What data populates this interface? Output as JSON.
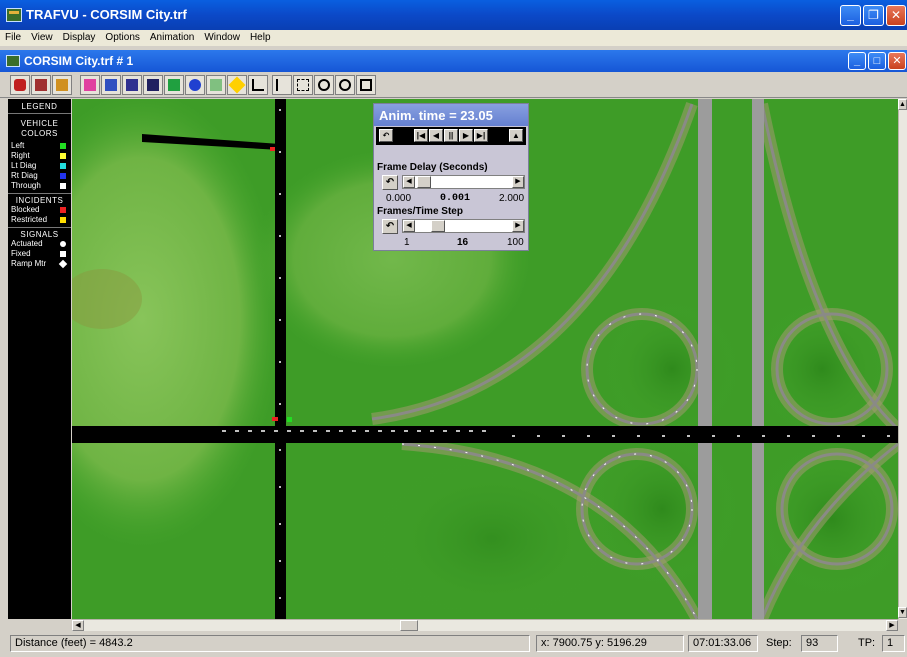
{
  "app": {
    "title": "TRAFVU - CORSIM City.trf"
  },
  "menu": [
    "File",
    "View",
    "Display",
    "Options",
    "Animation",
    "Window",
    "Help"
  ],
  "child": {
    "title": "CORSIM City.trf # 1"
  },
  "legend": {
    "header": "LEGEND",
    "vehicle_colors_title": "VEHICLE COLORS",
    "vehicle_colors": [
      {
        "label": "Left",
        "color": "#22dd22"
      },
      {
        "label": "Right",
        "color": "#ffff33"
      },
      {
        "label": "Lt Diag",
        "color": "#22dddd"
      },
      {
        "label": "Rt Diag",
        "color": "#2233ee"
      },
      {
        "label": "Through",
        "color": "#ffffff"
      }
    ],
    "incidents_title": "INCIDENTS",
    "incidents": [
      {
        "label": "Blocked",
        "color": "#ee2222"
      },
      {
        "label": "Restricted",
        "color": "#ffdd00"
      }
    ],
    "signals_title": "SIGNALS",
    "signals": [
      {
        "label": "Actuated",
        "shape": "circle"
      },
      {
        "label": "Fixed",
        "shape": "square"
      },
      {
        "label": "Ramp Mtr",
        "shape": "diamond"
      }
    ]
  },
  "anim": {
    "title": "Anim. time = 23.05",
    "frame_delay_label": "Frame Delay (Seconds)",
    "frame_delay_min": "0.000",
    "frame_delay_value": "0.001",
    "frame_delay_max": "2.000",
    "frames_label": "Frames/Time Step",
    "frames_min": "1",
    "frames_value": "16",
    "frames_max": "100"
  },
  "status": {
    "distance": "Distance (feet) =   4843.2",
    "coords": "x: 7900.75 y: 5196.29",
    "time": "07:01:33.06",
    "step_label": "Step:",
    "step_value": "93",
    "tp_label": "TP:",
    "tp_value": "1"
  },
  "colors": {
    "grass": "#3c9b25",
    "road": "#000000",
    "ramp": "#8a8a80",
    "freeway": "#9a9a9a"
  }
}
